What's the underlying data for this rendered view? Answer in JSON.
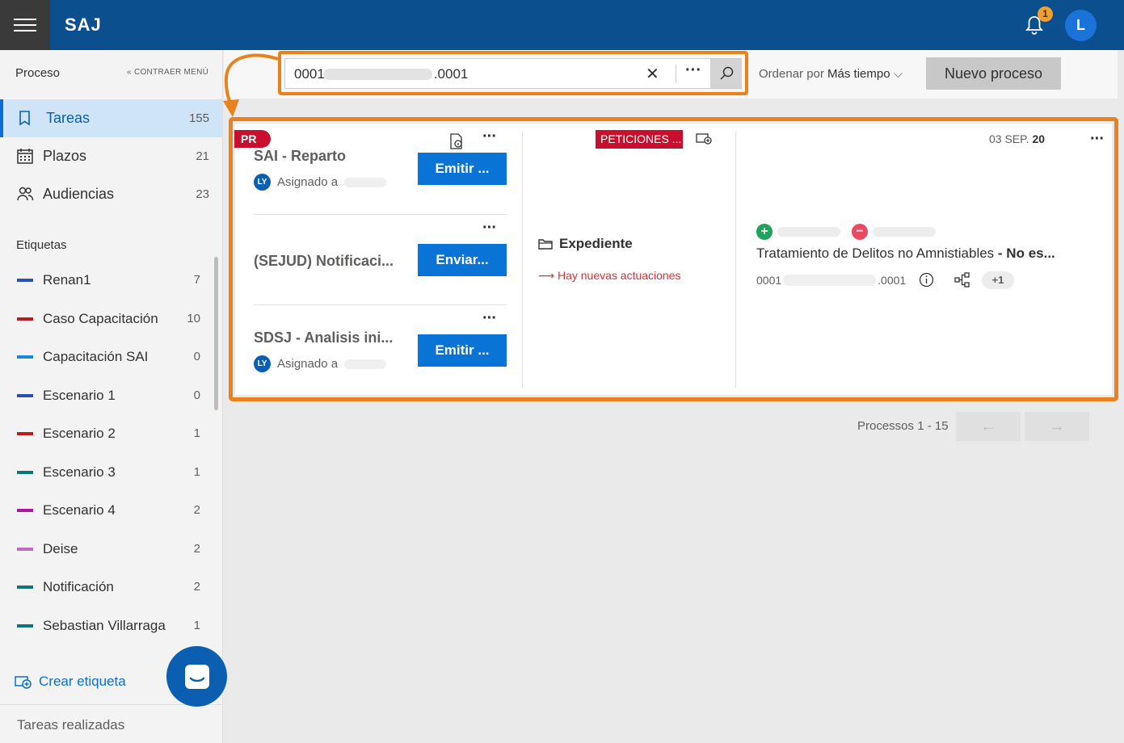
{
  "header": {
    "app_name": "SAJ",
    "notification_count": "1",
    "user_initial": "L"
  },
  "sidebar": {
    "section_title": "Proceso",
    "collapse_label": "CONTRAER MENÚ",
    "nav": [
      {
        "label": "Tareas",
        "count": "155",
        "icon": "book-icon",
        "active": true
      },
      {
        "label": "Plazos",
        "count": "21",
        "icon": "calendar-icon",
        "active": false
      },
      {
        "label": "Audiencias",
        "count": "23",
        "icon": "people-icon",
        "active": false
      }
    ],
    "tags_title": "Etiquetas",
    "tags": [
      {
        "label": "Renan1",
        "count": "7",
        "color": "#2c4fa8"
      },
      {
        "label": "Caso Capacitación",
        "count": "10",
        "color": "#b81c24"
      },
      {
        "label": "Capacitación SAI",
        "count": "0",
        "color": "#1a8ad6"
      },
      {
        "label": "Escenario 1",
        "count": "0",
        "color": "#2c4fa8"
      },
      {
        "label": "Escenario 2",
        "count": "1",
        "color": "#b81c24"
      },
      {
        "label": "Escenario 3",
        "count": "1",
        "color": "#0f7478"
      },
      {
        "label": "Escenario 4",
        "count": "2",
        "color": "#b0179e"
      },
      {
        "label": "Deise",
        "count": "2",
        "color": "#c06cbc"
      },
      {
        "label": "Notificación",
        "count": "2",
        "color": "#0f7478"
      },
      {
        "label": "Sebastian Villarraga",
        "count": "1",
        "color": "#0f7478"
      }
    ],
    "create_tag_label": "Crear etiqueta",
    "completed_tasks_label": "Tareas realizadas"
  },
  "toolbar": {
    "search_prefix": "0001",
    "search_suffix": ".0001",
    "sort_prefix": "Ordenar por",
    "sort_value": "Más tiempo",
    "new_process_label": "Nuevo proceso"
  },
  "card": {
    "badge": "PR",
    "tasks": [
      {
        "title": "SAI - Reparto",
        "assigned_label": "Asignado a",
        "avatar": "LY",
        "action": "Emitir ..."
      },
      {
        "title": "(SEJUD) Notificaci...",
        "assigned_label": "",
        "avatar": "",
        "action": "Enviar..."
      },
      {
        "title": "SDSJ - Analisis ini...",
        "assigned_label": "Asignado a",
        "avatar": "LY",
        "action": "Emitir ..."
      }
    ],
    "category_tag": "PETICIONES ...",
    "file_label": "Expediente",
    "new_actions_label": "Hay nuevas actuaciones",
    "date_prefix": "03 SEP.",
    "date_year": "20",
    "description": "Tratamiento de Delitos no Amnistiables",
    "description_suffix": "- No es...",
    "number_prefix": "0001",
    "number_suffix": ".0001",
    "extra_count": "+1"
  },
  "pager": {
    "label": "Processos 1 - 15",
    "prev": "←",
    "next": "→"
  },
  "colors": {
    "header_bg": "#0c4f8f",
    "accent_orange": "#e8821e",
    "primary_button": "#0a74d6",
    "danger_red": "#c8102e"
  }
}
